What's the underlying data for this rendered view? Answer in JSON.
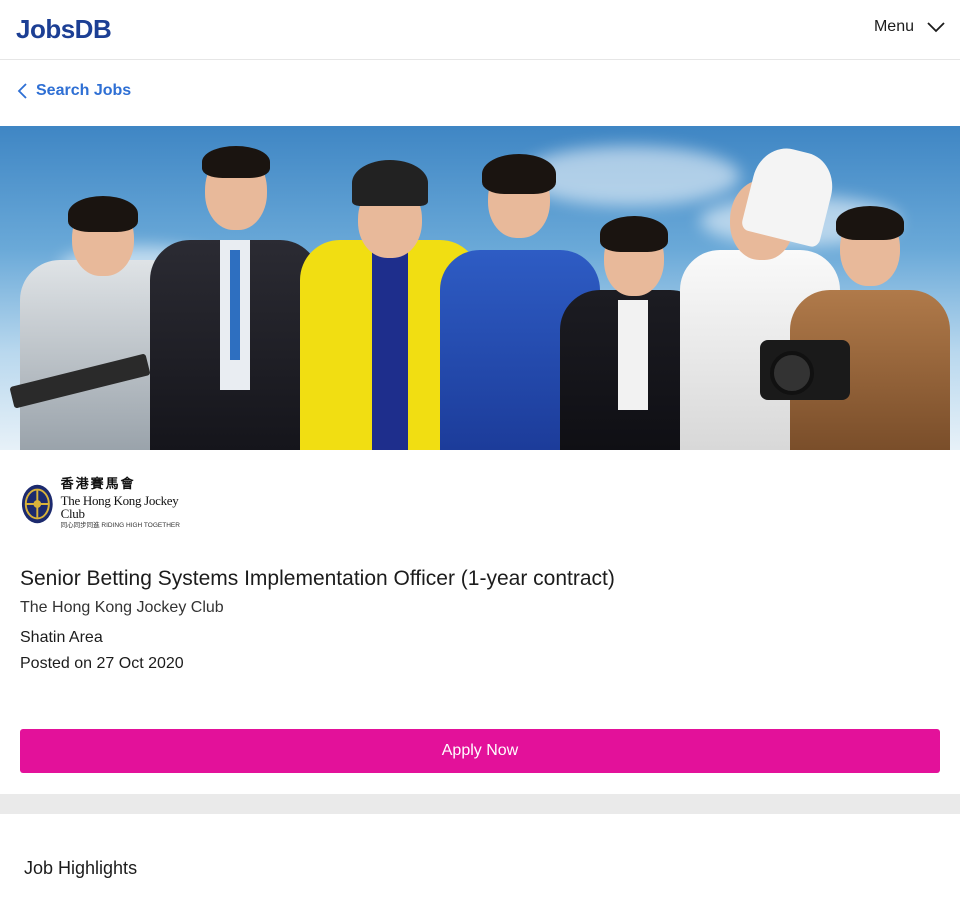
{
  "header": {
    "logo_text": "JobsDB",
    "menu_label": "Menu",
    "menu_icon": "chevron-down-icon"
  },
  "breadcrumb": {
    "back_icon": "chevron-left-icon",
    "label": "Search Jobs"
  },
  "company_logo": {
    "chinese_name": "香港賽馬會",
    "english_name": "The Hong Kong Jockey Club",
    "tagline": "同心同步同進 RIDING HIGH TOGETHER"
  },
  "job": {
    "title": "Senior Betting Systems Implementation Officer (1-year contract)",
    "company": "The Hong Kong Jockey Club",
    "location": "Shatin Area",
    "posted": "Posted on 27 Oct 2020"
  },
  "apply": {
    "label": "Apply Now"
  },
  "sections": {
    "highlights_title": "Job Highlights"
  },
  "colors": {
    "brand_blue": "#1c3f94",
    "link_blue": "#2e6fd4",
    "apply_pink": "#e3119a",
    "band_gray": "#eaeaea"
  }
}
